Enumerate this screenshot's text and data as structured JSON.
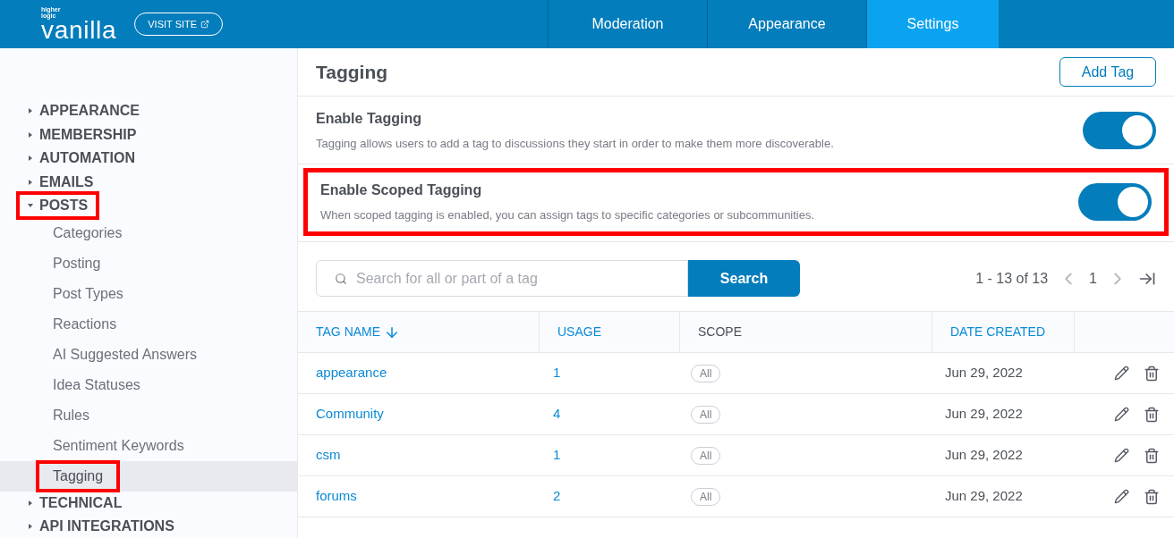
{
  "header": {
    "logo_small": "higher logic",
    "logo": "vanilla",
    "visit_site": "VISIT SITE",
    "nav": [
      {
        "label": "Moderation",
        "selected": false
      },
      {
        "label": "Appearance",
        "selected": false
      },
      {
        "label": "Settings",
        "selected": true
      }
    ]
  },
  "sidebar": {
    "items": [
      {
        "label": "APPEARANCE",
        "expanded": false,
        "highlighted": false
      },
      {
        "label": "MEMBERSHIP",
        "expanded": false,
        "highlighted": false
      },
      {
        "label": "AUTOMATION",
        "expanded": false,
        "highlighted": false
      },
      {
        "label": "EMAILS",
        "expanded": false,
        "highlighted": false
      },
      {
        "label": "POSTS",
        "expanded": true,
        "highlighted": true,
        "children": [
          {
            "label": "Categories",
            "selected": false,
            "highlighted": false
          },
          {
            "label": "Posting",
            "selected": false,
            "highlighted": false
          },
          {
            "label": "Post Types",
            "selected": false,
            "highlighted": false
          },
          {
            "label": "Reactions",
            "selected": false,
            "highlighted": false
          },
          {
            "label": "AI Suggested Answers",
            "selected": false,
            "highlighted": false
          },
          {
            "label": "Idea Statuses",
            "selected": false,
            "highlighted": false
          },
          {
            "label": "Rules",
            "selected": false,
            "highlighted": false
          },
          {
            "label": "Sentiment Keywords",
            "selected": false,
            "highlighted": false
          },
          {
            "label": "Tagging",
            "selected": true,
            "highlighted": true
          }
        ]
      },
      {
        "label": "TECHNICAL",
        "expanded": false,
        "highlighted": false
      },
      {
        "label": "API INTEGRATIONS",
        "expanded": false,
        "highlighted": false
      }
    ]
  },
  "page": {
    "title": "Tagging",
    "add_button": "Add Tag",
    "settings": [
      {
        "title": "Enable Tagging",
        "description": "Tagging allows users to add a tag to discussions they start in order to make them more discoverable.",
        "on": true,
        "highlighted": false
      },
      {
        "title": "Enable Scoped Tagging",
        "description": "When scoped tagging is enabled, you can assign tags to specific categories or subcommunities.",
        "on": true,
        "highlighted": true
      }
    ],
    "search": {
      "placeholder": "Search for all or part of a tag",
      "button": "Search"
    },
    "pagination": {
      "range": "1 - 13 of 13",
      "page": "1"
    },
    "table": {
      "columns": [
        {
          "label": "TAG NAME",
          "sortable": true
        },
        {
          "label": "USAGE",
          "sortable": true
        },
        {
          "label": "SCOPE",
          "sortable": false
        },
        {
          "label": "DATE CREATED",
          "sortable": true
        }
      ],
      "rows": [
        {
          "name": "appearance",
          "usage": "1",
          "scope": "All",
          "date": "Jun 29, 2022"
        },
        {
          "name": "Community",
          "usage": "4",
          "scope": "All",
          "date": "Jun 29, 2022"
        },
        {
          "name": "csm",
          "usage": "1",
          "scope": "All",
          "date": "Jun 29, 2022"
        },
        {
          "name": "forums",
          "usage": "2",
          "scope": "All",
          "date": "Jun 29, 2022"
        }
      ]
    }
  }
}
